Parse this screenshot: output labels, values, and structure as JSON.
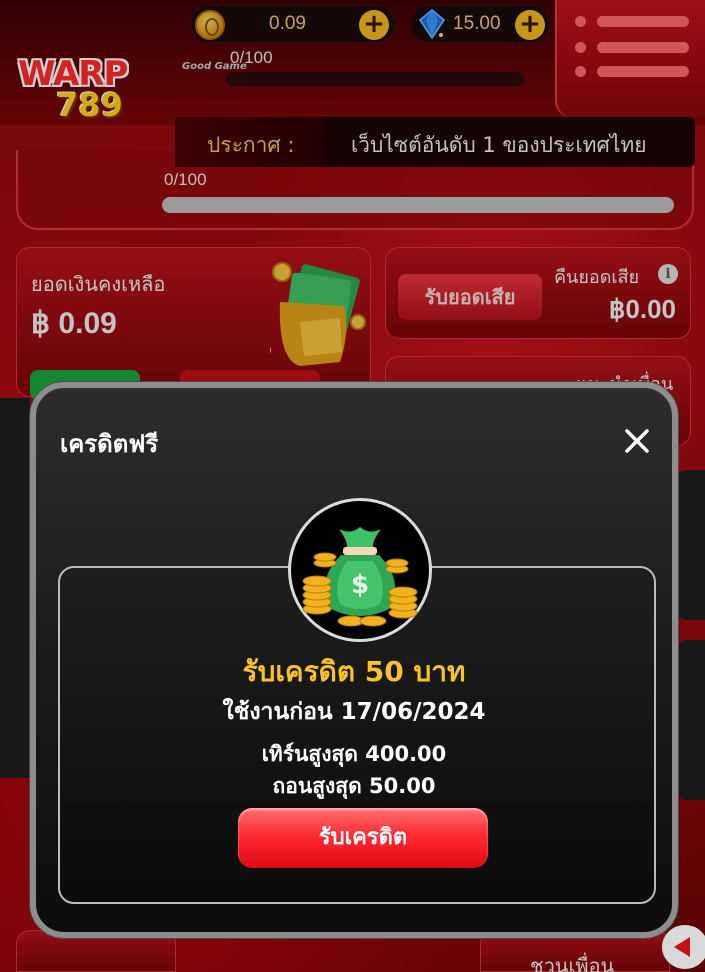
{
  "header": {
    "logo_text": "WARP",
    "logo_number": "789",
    "partner_logo": "Good Game",
    "coin_balance": "0.09",
    "gem_balance": "15.00",
    "progress_label": "0/100",
    "icons": {
      "coin": "coin-icon",
      "gem": "gem-icon",
      "add": "plus-icon",
      "menu": "hamburger-menu-icon"
    }
  },
  "announcement": {
    "label": "ประกาศ :",
    "text": "เว็บไซต์อันดับ 1 ของประเทศไทย"
  },
  "level": {
    "progress_label": "0/100"
  },
  "balance": {
    "title": "ยอดเงินคงเหลือ",
    "value": "฿ 0.09"
  },
  "refund": {
    "button_label": "รับยอดเสีย",
    "label": "คืนยอดเสีย",
    "value": "฿0.00"
  },
  "invite": {
    "label": "แนะนำเพื่อน"
  },
  "bottom": {
    "label": "ชวนเพื่อน"
  },
  "modal": {
    "title": "เครดิตฟรี",
    "offer_title": "รับเครดิต 50 บาท",
    "expiry": "ใช้งานก่อน 17/06/2024",
    "max_turnover": "เทิร์นสูงสุด 400.00",
    "max_withdraw": "ถอนสูงสุด 50.00",
    "claim_label": "รับเครดิต",
    "icons": {
      "close": "close-icon",
      "money_bag": "money-bag-icon"
    }
  },
  "colors": {
    "primary_red": "#c8141a",
    "gold": "#f8c22a",
    "button_red": "#ff2b34"
  }
}
